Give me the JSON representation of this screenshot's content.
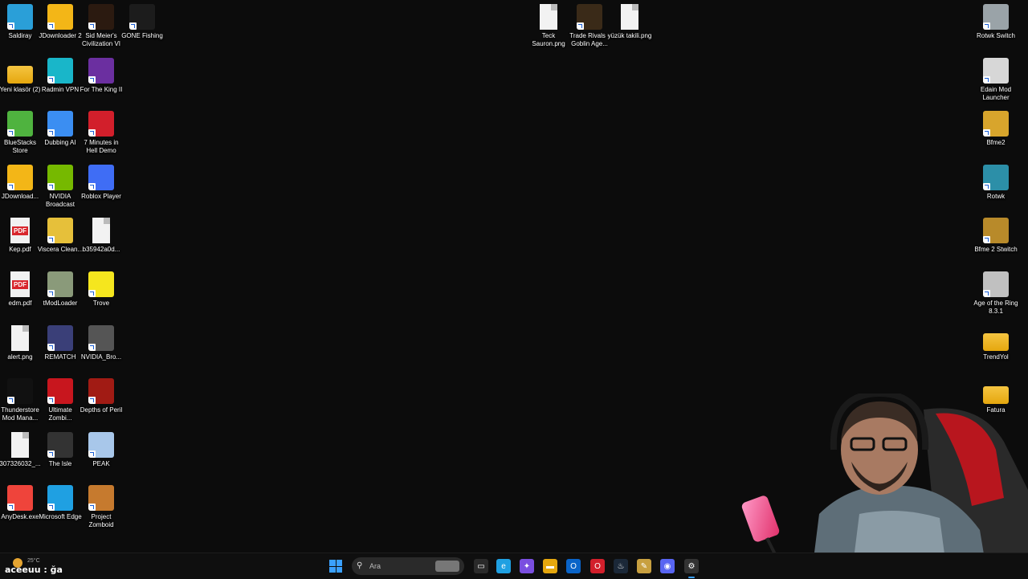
{
  "desktop": {
    "left_icons": [
      {
        "label": "Saldiray",
        "kind": "monitor",
        "color": "#2a9fd8"
      },
      {
        "label": "JDownloader 2",
        "kind": "jd",
        "color": "#f3b617"
      },
      {
        "label": "Sid Meier's Civilization VI",
        "kind": "civ",
        "color": "#2b1a10"
      },
      {
        "label": "GONE Fishing",
        "kind": "gone",
        "color": "#1c1c1c"
      },
      {
        "label": "Yeni klasör (2)",
        "kind": "folder",
        "color": "#f5c541"
      },
      {
        "label": "Radmin VPN",
        "kind": "radmin",
        "color": "#19b6c9"
      },
      {
        "label": "For The King II",
        "kind": "ftk",
        "color": "#6b2fa0"
      },
      {
        "label": "BlueStacks Store",
        "kind": "bluestacks",
        "color": "#4fb33f"
      },
      {
        "label": "Dubbing AI",
        "kind": "dubbing",
        "color": "#3b8ef2"
      },
      {
        "label": "7 Minutes in Hell Demo",
        "kind": "hell",
        "color": "#d21f2b"
      },
      {
        "label": "JDownload...",
        "kind": "jd",
        "color": "#f3b617"
      },
      {
        "label": "NVIDIA Broadcast",
        "kind": "nvb",
        "color": "#76b900"
      },
      {
        "label": "Roblox Player",
        "kind": "roblox",
        "color": "#3f6df5"
      },
      {
        "label": "Kep.pdf",
        "kind": "pdf",
        "color": "#d8262c"
      },
      {
        "label": "Viscera Clean...",
        "kind": "viscera",
        "color": "#e6c03a"
      },
      {
        "label": "b35942a0d...",
        "kind": "file",
        "color": "#f2f2f2"
      },
      {
        "label": "edm.pdf",
        "kind": "pdf",
        "color": "#d8262c"
      },
      {
        "label": "tModLoader",
        "kind": "tmod",
        "color": "#8a9a7a"
      },
      {
        "label": "Trove",
        "kind": "trove",
        "color": "#f5e61e"
      },
      {
        "label": "alert.png",
        "kind": "file",
        "color": "#f2f2f2"
      },
      {
        "label": "REMATCH",
        "kind": "rematch",
        "color": "#3a3f78"
      },
      {
        "label": "NVIDIA_Bro...",
        "kind": "nvb2",
        "color": "#555"
      },
      {
        "label": "Thunderstore Mod Mana...",
        "kind": "thunder",
        "color": "#111"
      },
      {
        "label": "Ultimate Zombi...",
        "kind": "zombie",
        "color": "#c8161e"
      },
      {
        "label": "Depths of Peril",
        "kind": "depths",
        "color": "#a11b14"
      },
      {
        "label": "307326032_...",
        "kind": "file",
        "color": "#f2f2f2"
      },
      {
        "label": "The Isle",
        "kind": "isle",
        "color": "#333"
      },
      {
        "label": "PEAK",
        "kind": "peak",
        "color": "#a8c7ea"
      },
      {
        "label": "AnyDesk.exe",
        "kind": "anydesk",
        "color": "#ef443b"
      },
      {
        "label": "Microsoft Edge",
        "kind": "edge",
        "color": "#1fa0e2"
      },
      {
        "label": "Project Zomboid",
        "kind": "zomboid",
        "color": "#c67a2e"
      }
    ],
    "top_center_icons": [
      {
        "label": "Teck Sauron.png",
        "kind": "file",
        "color": "#f2f2f2"
      },
      {
        "label": "Trade Rivals - Goblin Age...",
        "kind": "trade",
        "color": "#3a2a18"
      },
      {
        "label": "yüzük takili.png",
        "kind": "file",
        "color": "#f2f2f2"
      }
    ],
    "right_icons": [
      {
        "label": "Rotwk Switch",
        "kind": "rotwk",
        "color": "#9aa3a8"
      },
      {
        "label": "Edain Mod Launcher",
        "kind": "edain",
        "color": "#d7d7d7"
      },
      {
        "label": "Bfme2",
        "kind": "ring",
        "color": "#d8a52c"
      },
      {
        "label": "Rotwk",
        "kind": "rotwk2",
        "color": "#2c8fa8"
      },
      {
        "label": "Bfme 2 Stwitch",
        "kind": "ring",
        "color": "#b88a2a"
      },
      {
        "label": "Age of the Ring 8.3.1",
        "kind": "aotr",
        "color": "#c0c0c0"
      },
      {
        "label": "TrendYol",
        "kind": "folder",
        "color": "#f5c541"
      },
      {
        "label": "Fatura",
        "kind": "folder",
        "color": "#f5c541"
      }
    ]
  },
  "taskbar": {
    "weather_temp": "25°C",
    "overlay_text": "aceeuu : ğa",
    "search_placeholder": "Ara",
    "apps": [
      {
        "name": "task-view-icon",
        "glyph": "▭",
        "color": "#2a2a2a"
      },
      {
        "name": "edge-icon",
        "glyph": "e",
        "color": "#1fa0e2"
      },
      {
        "name": "copilot-icon",
        "glyph": "✦",
        "color": "#7a4fe0"
      },
      {
        "name": "file-explorer-icon",
        "glyph": "▬",
        "color": "#e5a70e"
      },
      {
        "name": "outlook-icon",
        "glyph": "O",
        "color": "#0a64c8"
      },
      {
        "name": "opera-icon",
        "glyph": "O",
        "color": "#d21f2b"
      },
      {
        "name": "steam-icon",
        "glyph": "♨",
        "color": "#1b2838"
      },
      {
        "name": "pen-tool-icon",
        "glyph": "✎",
        "color": "#c8a040"
      },
      {
        "name": "discord-icon",
        "glyph": "◉",
        "color": "#5865f2"
      },
      {
        "name": "settings-icon",
        "glyph": "⚙",
        "color": "#333"
      }
    ]
  }
}
